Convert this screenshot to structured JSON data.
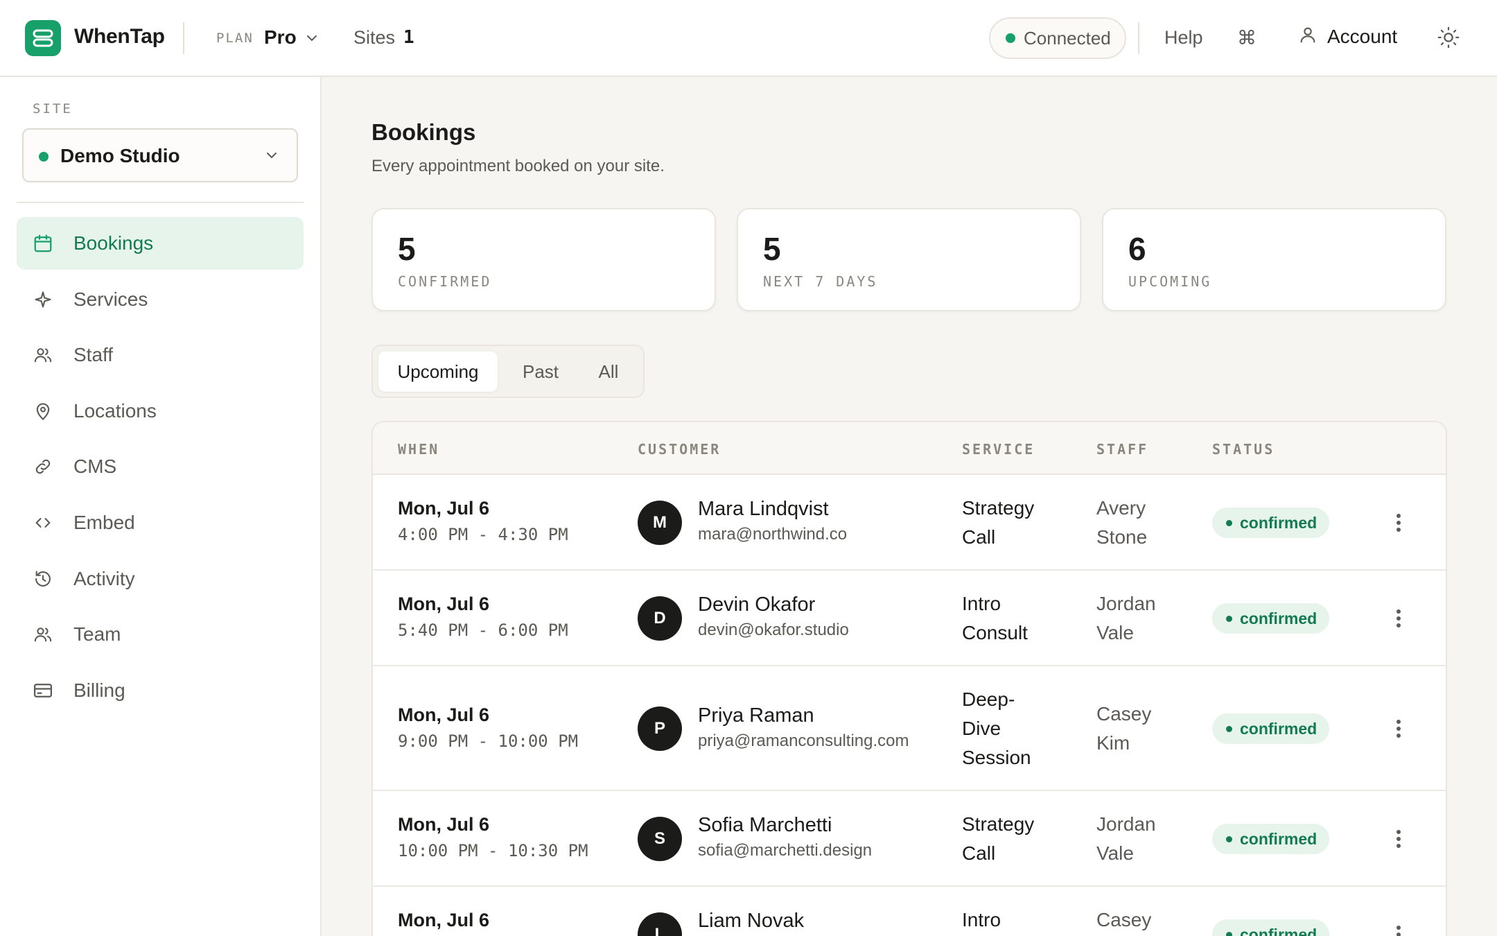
{
  "header": {
    "brand": "WhenTap",
    "plan_label": "PLAN",
    "plan_value": "Pro",
    "sites_label": "Sites",
    "sites_count": "1",
    "connection_status": "Connected",
    "help_label": "Help",
    "command_icon": "⌘",
    "account_label": "Account"
  },
  "sidebar": {
    "site_label": "SITE",
    "site_name": "Demo Studio",
    "items": [
      {
        "label": "Bookings",
        "icon": "calendar-icon",
        "active": true
      },
      {
        "label": "Services",
        "icon": "sparkle-icon"
      },
      {
        "label": "Staff",
        "icon": "users-icon"
      },
      {
        "label": "Locations",
        "icon": "map-pin-icon"
      },
      {
        "label": "CMS",
        "icon": "link-icon"
      },
      {
        "label": "Embed",
        "icon": "code-icon"
      },
      {
        "label": "Activity",
        "icon": "history-icon"
      },
      {
        "label": "Team",
        "icon": "users-icon"
      },
      {
        "label": "Billing",
        "icon": "credit-card-icon"
      }
    ]
  },
  "main": {
    "title": "Bookings",
    "subtitle": "Every appointment booked on your site.",
    "stats": [
      {
        "value": "5",
        "label": "CONFIRMED"
      },
      {
        "value": "5",
        "label": "NEXT 7 DAYS"
      },
      {
        "value": "6",
        "label": "UPCOMING"
      }
    ],
    "tabs": [
      {
        "label": "Upcoming",
        "active": true
      },
      {
        "label": "Past"
      },
      {
        "label": "All"
      }
    ],
    "table": {
      "columns": [
        "WHEN",
        "CUSTOMER",
        "SERVICE",
        "STAFF",
        "STATUS"
      ],
      "rows": [
        {
          "date": "Mon, Jul 6",
          "time": "4:00 PM - 4:30 PM",
          "initial": "M",
          "name": "Mara Lindqvist",
          "email": "mara@northwind.co",
          "service": [
            "Strategy",
            "Call"
          ],
          "staff": [
            "Avery",
            "Stone"
          ],
          "status": "confirmed"
        },
        {
          "date": "Mon, Jul 6",
          "time": "5:40 PM - 6:00 PM",
          "initial": "D",
          "name": "Devin Okafor",
          "email": "devin@okafor.studio",
          "service": [
            "Intro",
            "Consult"
          ],
          "staff": [
            "Jordan",
            "Vale"
          ],
          "status": "confirmed"
        },
        {
          "date": "Mon, Jul 6",
          "time": "9:00 PM - 10:00 PM",
          "initial": "P",
          "name": "Priya Raman",
          "email": "priya@ramanconsulting.com",
          "service": [
            "Deep-",
            "Dive",
            "Session"
          ],
          "staff": [
            "Casey",
            "Kim"
          ],
          "status": "confirmed"
        },
        {
          "date": "Mon, Jul 6",
          "time": "10:00 PM - 10:30 PM",
          "initial": "S",
          "name": "Sofia Marchetti",
          "email": "sofia@marchetti.design",
          "service": [
            "Strategy",
            "Call"
          ],
          "staff": [
            "Jordan",
            "Vale"
          ],
          "status": "confirmed"
        },
        {
          "date": "Mon, Jul 6",
          "time": "",
          "initial": "L",
          "name": "Liam Novak",
          "email": "",
          "service": [
            "Intro"
          ],
          "staff": [
            "Casey"
          ],
          "status": "confirmed"
        }
      ]
    }
  },
  "colors": {
    "accent": "#17a06a",
    "accent_dark": "#137a52",
    "accent_soft": "#e6f4ec",
    "background": "#f6f5f1"
  }
}
